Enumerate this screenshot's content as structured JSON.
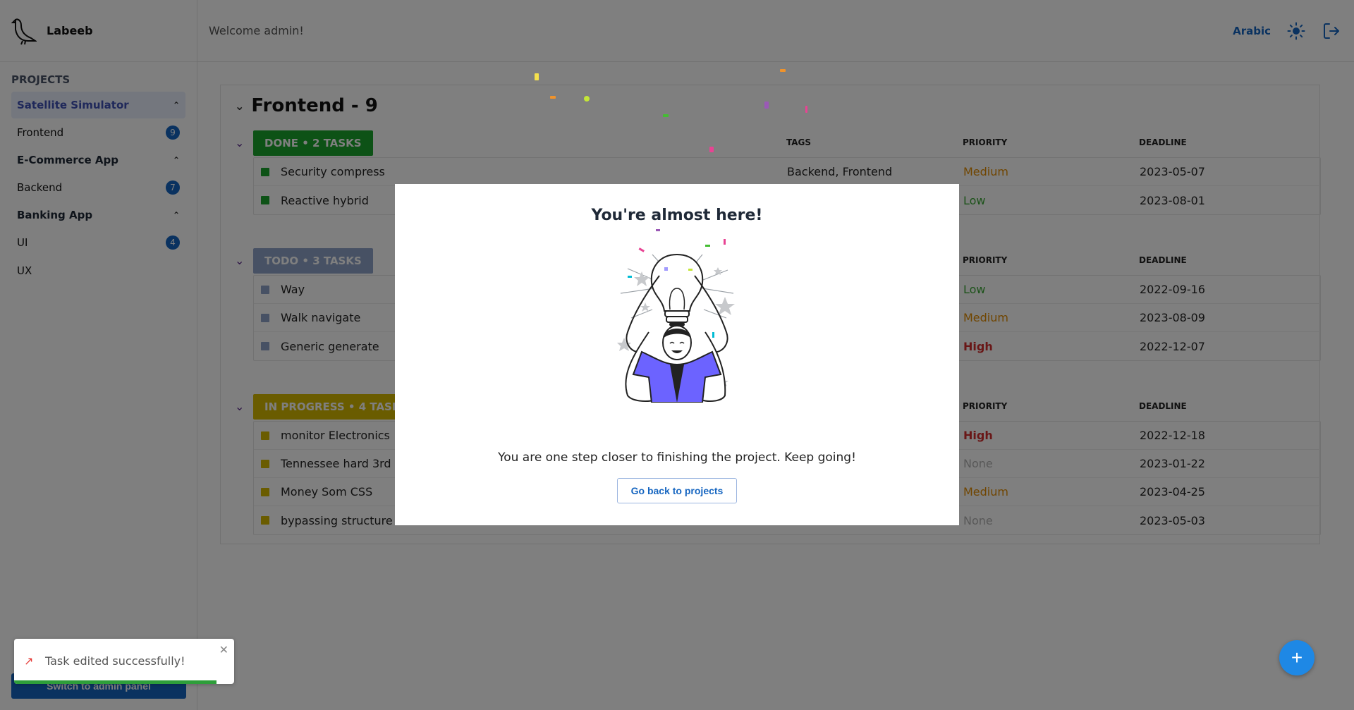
{
  "app": {
    "name": "Labeeb"
  },
  "header": {
    "welcome": "Welcome admin!",
    "language": "Arabic",
    "theme_icon": "sun-icon",
    "logout_icon": "logout-icon"
  },
  "sidebar": {
    "heading": "PROJECTS",
    "projects": [
      {
        "label": "Satellite Simulator",
        "active": true,
        "children": [
          {
            "label": "Frontend",
            "count": "9"
          }
        ]
      },
      {
        "label": "E-Commerce App",
        "active": false,
        "children": [
          {
            "label": "Backend",
            "count": "7"
          }
        ]
      },
      {
        "label": "Banking App",
        "active": false,
        "children": [
          {
            "label": "UI",
            "count": "4"
          },
          {
            "label": "UX",
            "count": ""
          }
        ]
      }
    ],
    "admin_button": "Switch to admin panel"
  },
  "board": {
    "title": "Frontend - 9",
    "columns": {
      "tags": "TAGS",
      "priority": "PRIORITY",
      "deadline": "DEADLINE"
    },
    "sections": [
      {
        "label": "DONE • 2 TASKS",
        "color": "#1aa52c",
        "tasks": [
          {
            "name": "Security compress",
            "tags": "Backend, Frontend",
            "priority": "Medium",
            "deadline": "2023-05-07"
          },
          {
            "name": "Reactive hybrid",
            "tags": "",
            "priority": "Low",
            "deadline": "2023-08-01"
          }
        ]
      },
      {
        "label": "TODO • 3 TASKS",
        "color": "#8fa3c8",
        "tasks": [
          {
            "name": "Way",
            "tags": "",
            "priority": "Low",
            "deadline": "2022-09-16"
          },
          {
            "name": "Walk navigate",
            "tags": "",
            "priority": "Medium",
            "deadline": "2023-08-09"
          },
          {
            "name": "Generic generate",
            "tags": "",
            "priority": "High",
            "deadline": "2022-12-07"
          }
        ]
      },
      {
        "label": "IN PROGRESS • 4 TASKS",
        "color": "#d4b800",
        "tasks": [
          {
            "name": "monitor Electronics",
            "tags": "",
            "priority": "High",
            "deadline": "2022-12-18"
          },
          {
            "name": "Tennessee hard 3rd",
            "tags": "",
            "priority": "None",
            "deadline": "2023-01-22"
          },
          {
            "name": "Money Som CSS",
            "tags": "",
            "priority": "Medium",
            "deadline": "2023-04-25"
          },
          {
            "name": "bypassing structure",
            "tags": "",
            "priority": "None",
            "deadline": "2023-05-03"
          }
        ]
      }
    ],
    "priority_colors": {
      "High": "#d32f2f",
      "Medium": "#e08a00",
      "Low": "#3aa635",
      "None": "#b0b0b0"
    }
  },
  "modal": {
    "title": "You're almost here!",
    "message": "You are one step closer to finishing the project. Keep going!",
    "button": "Go back to projects",
    "accent": "#6c63ff"
  },
  "toast": {
    "icon": "rocket-icon",
    "message": "Task edited successfully!",
    "progress": 0.92
  },
  "fab": {
    "label": "+"
  }
}
